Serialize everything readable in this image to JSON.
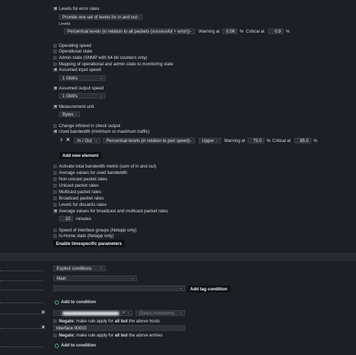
{
  "levels_error": {
    "label": "Levels for error rates",
    "mode": "Provide one set of levels for in and out",
    "levels_label": "Levels",
    "level_type": "Percentual levels (in relation to all packets (successful + error))",
    "warn_label": "Warning at",
    "warn": "0.06",
    "crit_label": "Critical at",
    "crit": "0.9",
    "unit": "%"
  },
  "options": {
    "operating_speed": "Operating speed",
    "operational_state": "Operational state",
    "admin_state": "Admin state (SNMP with 64-bit counters only)",
    "mapping": "Mapping of operational and admin state to monitoring state",
    "assumed_input": "Assumed input speed",
    "input_speed": "1 Gbit/s",
    "assumed_output": "Assumed output speed",
    "output_speed": "1 Gbit/s",
    "measurement_unit": "Measurement unit",
    "unit_value": "Bytes",
    "infotext": "Change infotext in check output",
    "used_bandwidth": "Used bandwidth (minimum or maximum traffic)"
  },
  "bandwidth_row": {
    "direction": "In / Out",
    "type": "Percentual levels (in relation to port speed)",
    "bound": "Upper",
    "warn_label": "Warning at",
    "warn": "75.0",
    "crit_label": "Critical at",
    "crit": "85.0",
    "unit": "%"
  },
  "add_new_element": "Add new element",
  "options2": {
    "total_bw": "Activate total bandwidth metric (sum of in and out)",
    "avg_used_bw": "Average values for used bandwidth",
    "nonunicast": "Non-unicast packet rates",
    "unicast": "Unicast packet rates",
    "multicast": "Multicast packet rates",
    "broadcast": "Broadcast packet rates",
    "discards": "Levels for discards rates",
    "avg_bcast": "Average values for broadcast and multicast packet rates",
    "minutes_value": "10",
    "minutes_label": "minutes",
    "group_speed": "Speed of interface groups (Netapp only)",
    "is_home": "Is-Home state (Netapp only)"
  },
  "enable_timespecific": "Enable timespecific parameters",
  "conditions": {
    "type": "Explicit conditions",
    "folder": "Main",
    "add_tag_condition": "Add tag condition",
    "add_to_condition": "Add to condition",
    "select_hostname": "(Select hostname)",
    "negate_label": "Negate:",
    "negate_hosts_1": " make rule apply for ",
    "negate_hosts_bold": "all but",
    "negate_hosts_2": " the above hosts",
    "interface_value": "Interface 00010",
    "negate_entries_2": " the above entries",
    "add_to_condition_2": "Add to condition"
  }
}
